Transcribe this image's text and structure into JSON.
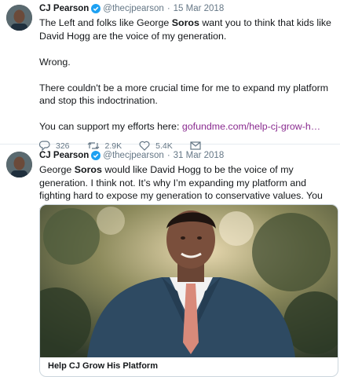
{
  "tweets": [
    {
      "author": "CJ Pearson",
      "handle": "@thecjpearson",
      "date": "15 Mar 2018",
      "text": {
        "l1a": "The Left and folks like George ",
        "l1b": "Soros",
        "l1c": " want you to think that kids like David Hogg are the voice of my generation.",
        "p2": "Wrong.",
        "p3": "There couldn't be a more crucial time for me to expand my platform and stop this indoctrination.",
        "p4": "You can support my efforts here: ",
        "link": "gofundme.com/help-cj-grow-h…"
      },
      "replies": "326",
      "retweets": "2.9K",
      "likes": "5.4K"
    },
    {
      "author": "CJ Pearson",
      "handle": "@thecjpearson",
      "date": "31 Mar 2018",
      "text": {
        "l1a": "George ",
        "l1b": "Soros",
        "l1c": " would like David Hogg to be the voice of my generation. I think not. It’s why I’m expanding my platform and fighting hard to expose my generation to conservative values. You can support my efforts here:"
      },
      "card_title": "Help CJ Grow His Platform"
    }
  ],
  "colors": {
    "verified": "#1da1f2",
    "link": "#8a2c90",
    "muted": "#657786",
    "suit": "#2e4a62",
    "tie": "#d98a7a"
  },
  "icons": [
    "verified-badge-icon",
    "reply-icon",
    "retweet-icon",
    "like-icon",
    "message-icon"
  ]
}
